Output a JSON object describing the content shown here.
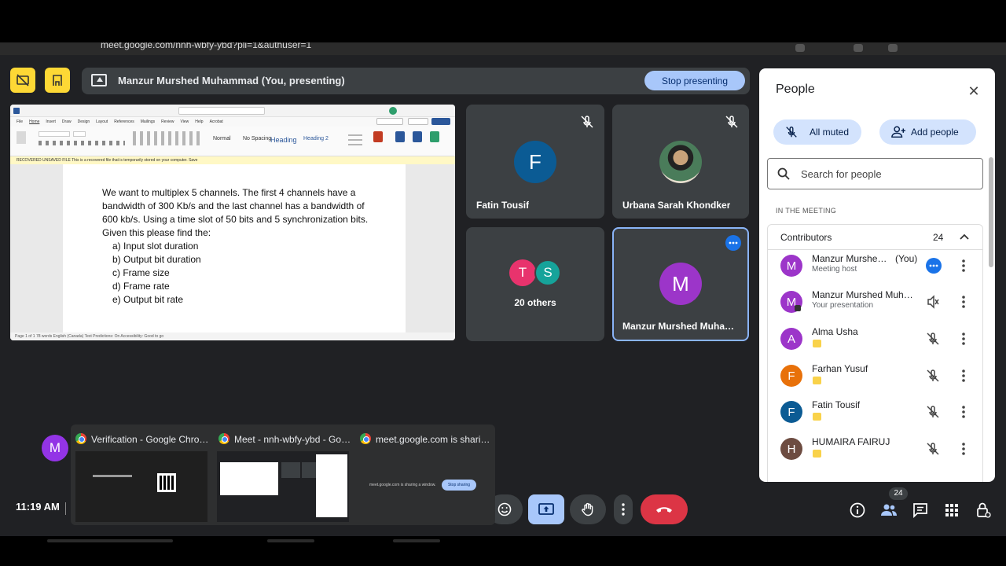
{
  "browser": {
    "url_text": "meet.google.com/nnh-wbfy-ybd?pli=1&authuser=1"
  },
  "presenting_bar": {
    "text": "Manzur Murshed Muhammad (You, presenting)",
    "stop_label": "Stop presenting"
  },
  "document": {
    "menu": [
      "File",
      "Home",
      "Insert",
      "Draw",
      "Design",
      "Layout",
      "References",
      "Mailings",
      "Review",
      "View",
      "Help",
      "Acrobat"
    ],
    "styles": [
      "Normal",
      "No Spacing",
      "Heading",
      "Heading 2"
    ],
    "warning": "RECOVERED UNSAVED FILE   This is a recovered file that is temporarily stored on your computer.   Save",
    "status": "Page 1 of 1    78 words    English (Canada)    Text Predictions: On    Accessibility: Good to go",
    "paragraph": "We want to multiplex 5 channels. The first 4 channels have a bandwidth of 300 Kb/s and the last channel has a bandwidth of 600 kb/s. Using a time slot of 50 bits and 5 synchronization bits. Given this please find the:",
    "items": [
      "a) Input slot duration",
      "b) Output bit duration",
      "c) Frame size",
      "d) Frame rate",
      "e) Output bit rate"
    ]
  },
  "tiles": {
    "fatin": {
      "initial": "F",
      "name": "Fatin Tousif",
      "color": "#0b5b94"
    },
    "urbana": {
      "name": "Urbana Sarah Khondker"
    },
    "others": {
      "initial_1": "T",
      "initial_2": "S",
      "label": "20 others",
      "color_1": "#e8336d",
      "color_2": "#16a39a"
    },
    "manzur": {
      "initial": "M",
      "name": "Manzur Murshed Muham...",
      "color": "#9c35c9"
    }
  },
  "people_panel": {
    "title": "People",
    "all_muted_label": "All muted",
    "add_people_label": "Add people",
    "search_placeholder": "Search for people",
    "section_label": "IN THE MEETING",
    "contributors_label": "Contributors",
    "contributors_count": "24",
    "people": [
      {
        "initial": "M",
        "name": "Manzur Murshed ...",
        "you": "(You)",
        "sub": "Meeting host",
        "color": "#9c35c9"
      },
      {
        "initial": "M",
        "name": "Manzur Murshed Muha...",
        "sub": "Your presentation",
        "color": "#9c35c9"
      },
      {
        "initial": "A",
        "name": "Alma Usha",
        "color": "#9c35c9"
      },
      {
        "initial": "F",
        "name": "Farhan Yusuf",
        "color": "#e8710a"
      },
      {
        "initial": "F",
        "name": "Fatin Tousif",
        "color": "#0b5b94"
      },
      {
        "initial": "H",
        "name": "HUMAIRA FAIRUJ",
        "color": "#6d4c41"
      }
    ]
  },
  "controls": {
    "time": "11:19 AM",
    "people_badge": "24"
  },
  "switcher": {
    "user_initial": "M",
    "windows": [
      {
        "title": "Verification - Google Chrome"
      },
      {
        "title": "Meet - nnh-wbfy-ybd - Goo..."
      },
      {
        "title": "meet.google.com is sharing..."
      }
    ],
    "sharing_text": "meet.google.com is sharing a window.",
    "sharing_stop": "Stop sharing"
  },
  "colors": {
    "accent": "#a8c7fa",
    "end_call": "#ea4335",
    "presenting_active": "#a8c7fa",
    "yellow": "#fdd835"
  }
}
